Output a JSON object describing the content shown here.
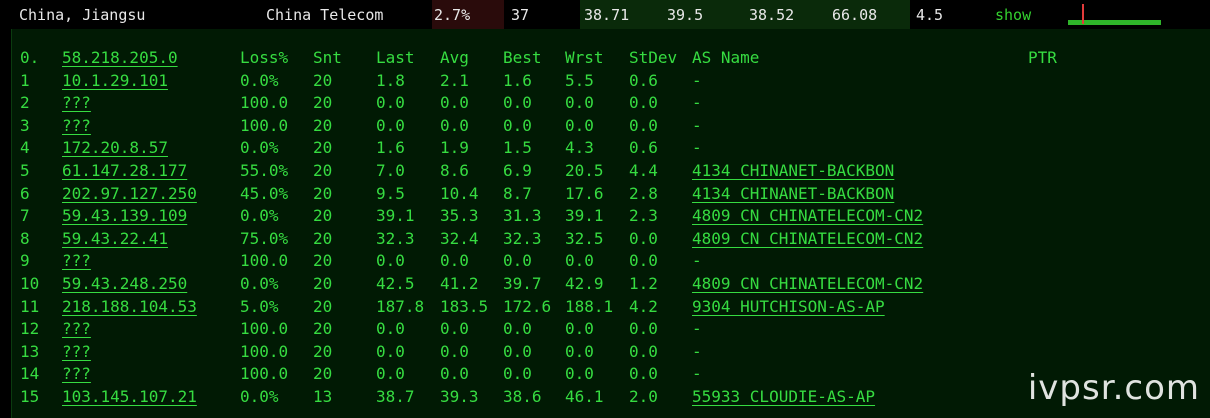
{
  "summary": {
    "location": "China, Jiangsu",
    "isp": "China Telecom",
    "loss": "2.7%",
    "sent": "37",
    "last": "38.71",
    "avg": "39.5",
    "best": "38.52",
    "worst": "66.08",
    "stdev": "4.5",
    "show_label": "show"
  },
  "table": {
    "headers": {
      "hop": "0.",
      "host": "58.218.205.0",
      "loss": "Loss%",
      "snt": "Snt",
      "last": "Last",
      "avg": "Avg",
      "best": "Best",
      "wrst": "Wrst",
      "stdev": "StDev",
      "asname": "AS Name",
      "ptr": "PTR"
    },
    "rows": [
      {
        "hop": "1",
        "host": "10.1.29.101",
        "loss": "0.0%",
        "snt": "20",
        "last": "1.8",
        "avg": "2.1",
        "best": "1.6",
        "wrst": "5.5",
        "stdev": "0.6",
        "asname": "-"
      },
      {
        "hop": "2",
        "host": "???",
        "loss": "100.0",
        "snt": "20",
        "last": "0.0",
        "avg": "0.0",
        "best": "0.0",
        "wrst": "0.0",
        "stdev": "0.0",
        "asname": "-"
      },
      {
        "hop": "3",
        "host": "???",
        "loss": "100.0",
        "snt": "20",
        "last": "0.0",
        "avg": "0.0",
        "best": "0.0",
        "wrst": "0.0",
        "stdev": "0.0",
        "asname": "-"
      },
      {
        "hop": "4",
        "host": "172.20.8.57",
        "loss": "0.0%",
        "snt": "20",
        "last": "1.6",
        "avg": "1.9",
        "best": "1.5",
        "wrst": "4.3",
        "stdev": "0.6",
        "asname": "-"
      },
      {
        "hop": "5",
        "host": "61.147.28.177",
        "loss": "55.0%",
        "snt": "20",
        "last": "7.0",
        "avg": "8.6",
        "best": "6.9",
        "wrst": "20.5",
        "stdev": "4.4",
        "asname": "4134  CHINANET-BACKBON"
      },
      {
        "hop": "6",
        "host": "202.97.127.250",
        "loss": "45.0%",
        "snt": "20",
        "last": "9.5",
        "avg": "10.4",
        "best": "8.7",
        "wrst": "17.6",
        "stdev": "2.8",
        "asname": "4134  CHINANET-BACKBON"
      },
      {
        "hop": "7",
        "host": "59.43.139.109",
        "loss": "0.0%",
        "snt": "20",
        "last": "39.1",
        "avg": "35.3",
        "best": "31.3",
        "wrst": "39.1",
        "stdev": "2.3",
        "asname": "4809  CN CHINATELECOM-CN2"
      },
      {
        "hop": "8",
        "host": "59.43.22.41",
        "loss": "75.0%",
        "snt": "20",
        "last": "32.3",
        "avg": "32.4",
        "best": "32.3",
        "wrst": "32.5",
        "stdev": "0.0",
        "asname": "4809  CN CHINATELECOM-CN2"
      },
      {
        "hop": "9",
        "host": "???",
        "loss": "100.0",
        "snt": "20",
        "last": "0.0",
        "avg": "0.0",
        "best": "0.0",
        "wrst": "0.0",
        "stdev": "0.0",
        "asname": "-"
      },
      {
        "hop": "10",
        "host": "59.43.248.250",
        "loss": "0.0%",
        "snt": "20",
        "last": "42.5",
        "avg": "41.2",
        "best": "39.7",
        "wrst": "42.9",
        "stdev": "1.2",
        "asname": "4809  CN CHINATELECOM-CN2"
      },
      {
        "hop": "11",
        "host": "218.188.104.53",
        "loss": "5.0%",
        "snt": "20",
        "last": "187.8",
        "avg": "183.5",
        "best": "172.6",
        "wrst": "188.1",
        "stdev": "4.2",
        "asname": "9304  HUTCHISON-AS-AP"
      },
      {
        "hop": "12",
        "host": "???",
        "loss": "100.0",
        "snt": "20",
        "last": "0.0",
        "avg": "0.0",
        "best": "0.0",
        "wrst": "0.0",
        "stdev": "0.0",
        "asname": "-"
      },
      {
        "hop": "13",
        "host": "???",
        "loss": "100.0",
        "snt": "20",
        "last": "0.0",
        "avg": "0.0",
        "best": "0.0",
        "wrst": "0.0",
        "stdev": "0.0",
        "asname": "-"
      },
      {
        "hop": "14",
        "host": "???",
        "loss": "100.0",
        "snt": "20",
        "last": "0.0",
        "avg": "0.0",
        "best": "0.0",
        "wrst": "0.0",
        "stdev": "0.0",
        "asname": "-"
      },
      {
        "hop": "15",
        "host": "103.145.107.21",
        "loss": "0.0%",
        "snt": "13",
        "last": "38.7",
        "avg": "39.3",
        "best": "38.6",
        "wrst": "46.1",
        "stdev": "2.0",
        "asname": "55933 CLOUDIE-AS-AP"
      }
    ]
  },
  "watermark": "ivpsr.com",
  "colors": {
    "terminal_green": "#36dc41",
    "panel_bg": "#011a04",
    "summary_text": "#e8e8e8",
    "spark_green": "#2fb52a",
    "spark_red": "#e23b3b"
  }
}
